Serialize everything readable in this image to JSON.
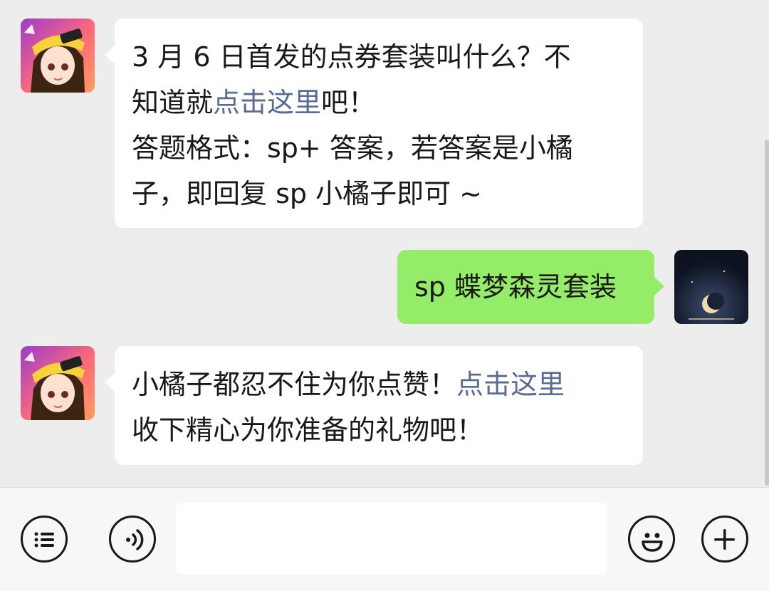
{
  "messages": [
    {
      "direction": "incoming",
      "sender_avatar": "game-mascot-avatar",
      "line1": "3 月 6 日首发的点券套装叫什么？不",
      "line2_pre": "知道就",
      "line2_link": "点击这里",
      "line2_post": "吧！",
      "line3": "答题格式：sp+ 答案，若答案是小橘",
      "line4": "子，即回复 sp 小橘子即可 ~"
    },
    {
      "direction": "outgoing",
      "sender_avatar": "moon-night-avatar",
      "text": "sp 蝶梦森灵套装"
    },
    {
      "direction": "incoming",
      "sender_avatar": "game-mascot-avatar",
      "line1_pre": "小橘子都忍不住为你点赞！",
      "line1_link": "点击这里",
      "line2": "收下精心为你准备的礼物吧！"
    }
  ],
  "toolbar": {
    "menu_icon": "list-menu-icon",
    "voice_icon": "voice-icon",
    "input_value": "",
    "emoji_icon": "emoji-icon",
    "add_icon": "plus-icon"
  },
  "colors": {
    "background": "#ededed",
    "incoming_bubble": "#ffffff",
    "outgoing_bubble": "#95ec69",
    "link": "#576b95"
  }
}
